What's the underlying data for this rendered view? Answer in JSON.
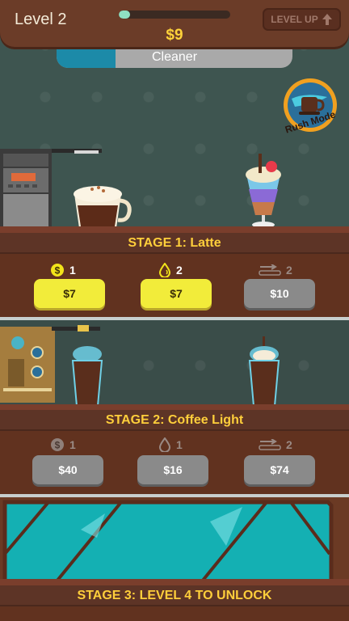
{
  "header": {
    "level_label": "Level 2",
    "money": "$9",
    "level_up_label": "LEVEL UP",
    "xp_progress": 0.1
  },
  "cleaner": {
    "label": "Cleaner",
    "progress": 0.25
  },
  "rush_mode": {
    "label": "Rush Mode"
  },
  "stages": [
    {
      "title": "STAGE 1: Latte",
      "upgrades": [
        {
          "icon": "coin-icon",
          "level": "1",
          "price": "$7",
          "style": "yellow"
        },
        {
          "icon": "drop-icon",
          "level": "2",
          "price": "$7",
          "style": "yellow"
        },
        {
          "icon": "conveyor-icon",
          "level": "2",
          "price": "$10",
          "style": "gray"
        }
      ]
    },
    {
      "title": "STAGE 2: Coffee Light",
      "upgrades": [
        {
          "icon": "coin-icon",
          "level": "1",
          "price": "$40",
          "style": "gray"
        },
        {
          "icon": "drop-icon",
          "level": "1",
          "price": "$16",
          "style": "gray"
        },
        {
          "icon": "conveyor-icon",
          "level": "2",
          "price": "$74",
          "style": "gray"
        }
      ]
    },
    {
      "title": "STAGE 3: LEVEL 4 TO UNLOCK"
    }
  ],
  "colors": {
    "accent_yellow": "#f2ec3a",
    "title_yellow": "#ffcf3b",
    "brown": "#6b3c28"
  }
}
